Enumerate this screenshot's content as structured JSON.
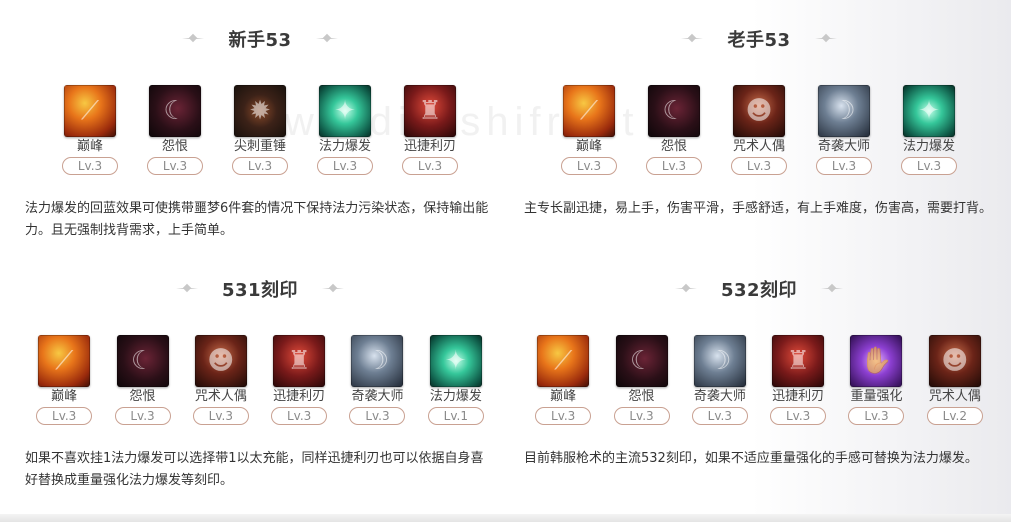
{
  "watermark": "www.diershifront",
  "sections": {
    "s1": {
      "title": "新手53",
      "runes": [
        {
          "name": "巅峰",
          "level": "Lv.3",
          "icon": "fire-spear-icon"
        },
        {
          "name": "怨恨",
          "level": "Lv.3",
          "icon": "beast-icon"
        },
        {
          "name": "尖刺重锤",
          "level": "Lv.3",
          "icon": "spiked-mace-icon"
        },
        {
          "name": "法力爆发",
          "level": "Lv.3",
          "icon": "mana-burst-icon"
        },
        {
          "name": "迅捷利刃",
          "level": "Lv.3",
          "icon": "swift-blade-icon"
        }
      ],
      "desc": "法力爆发的回蓝效果可使携带噩梦6件套的情况下保持法力污染状态，保持输出能力。且无强制找背需求，上手简单。"
    },
    "s2": {
      "title": "老手53",
      "runes": [
        {
          "name": "巅峰",
          "level": "Lv.3",
          "icon": "fire-spear-icon"
        },
        {
          "name": "怨恨",
          "level": "Lv.3",
          "icon": "beast-icon"
        },
        {
          "name": "咒术人偶",
          "level": "Lv.3",
          "icon": "cursed-doll-icon"
        },
        {
          "name": "奇袭大师",
          "level": "Lv.3",
          "icon": "ambush-master-icon"
        },
        {
          "name": "法力爆发",
          "level": "Lv.3",
          "icon": "mana-burst-icon"
        }
      ],
      "desc": "主专长副迅捷，易上手，伤害平滑，手感舒适，有上手难度，伤害高，需要打背。"
    },
    "s3": {
      "title": "531刻印",
      "runes": [
        {
          "name": "巅峰",
          "level": "Lv.3",
          "icon": "fire-spear-icon"
        },
        {
          "name": "怨恨",
          "level": "Lv.3",
          "icon": "beast-icon"
        },
        {
          "name": "咒术人偶",
          "level": "Lv.3",
          "icon": "cursed-doll-icon"
        },
        {
          "name": "迅捷利刃",
          "level": "Lv.3",
          "icon": "swift-blade-icon"
        },
        {
          "name": "奇袭大师",
          "level": "Lv.3",
          "icon": "ambush-master-icon"
        },
        {
          "name": "法力爆发",
          "level": "Lv.1",
          "icon": "mana-burst-icon"
        }
      ],
      "desc": "如果不喜欢挂1法力爆发可以选择带1以太充能，同样迅捷利刃也可以依据自身喜好替换成重量强化法力爆发等刻印。"
    },
    "s4": {
      "title": "532刻印",
      "runes": [
        {
          "name": "巅峰",
          "level": "Lv.3",
          "icon": "fire-spear-icon"
        },
        {
          "name": "怨恨",
          "level": "Lv.3",
          "icon": "beast-icon"
        },
        {
          "name": "奇袭大师",
          "level": "Lv.3",
          "icon": "ambush-master-icon"
        },
        {
          "name": "迅捷利刃",
          "level": "Lv.3",
          "icon": "swift-blade-icon"
        },
        {
          "name": "重量强化",
          "level": "Lv.3",
          "icon": "heavy-strengthen-icon"
        },
        {
          "name": "咒术人偶",
          "level": "Lv.2",
          "icon": "cursed-doll-icon"
        }
      ],
      "desc": "目前韩服枪术的主流532刻印，如果不适应重量强化的手感可替换为法力爆发。"
    }
  }
}
